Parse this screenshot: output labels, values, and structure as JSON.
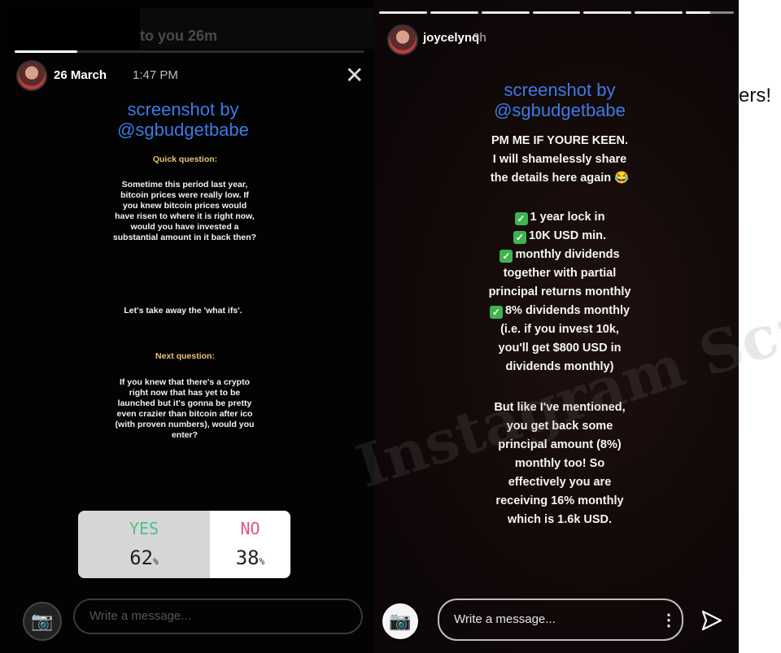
{
  "page": {
    "side_text": "ers!",
    "watermark": "Instagram Scammers"
  },
  "story1": {
    "behind_text": "to you 26m",
    "date": "26 March",
    "time": "1:47 PM",
    "close_icon": "close-icon",
    "progress_fraction": 0.18,
    "caption_line1": "screenshot by",
    "caption_line2": "@sgbudgetbabe",
    "q1_heading": "Quick question:",
    "q1_text": "Sometime this period last year, bitcoin prices were really low. If you knew bitcoin prices would have risen to where it is right now, would you have invested a substantial amount in it back then?",
    "q1_followup": "Let's take away the 'what ifs'.",
    "q2_heading": "Next question:",
    "q2_text": "If you knew that there's a crypto right now that has yet to be launched but it's gonna be pretty even crazier than bitcoin after ico (with proven numbers), would you enter?",
    "poll": {
      "yes_label": "YES",
      "yes_pct": "62",
      "no_label": "NO",
      "no_pct": "38",
      "pct_sign": "%",
      "yes_color": "#4fc08a",
      "no_color": "#e0557a"
    },
    "message_placeholder": "Write a message..."
  },
  "story2": {
    "username": "joycelynq",
    "time": "3h",
    "progress_segments": 7,
    "progress_last_fraction": 0.5,
    "caption_line1": "screenshot by",
    "caption_line2": "@sgbudgetbabe",
    "intro_line1": "PM ME IF YOURE KEEN.",
    "intro_line2": "I will shamelessly share",
    "intro_line3": "the details here again 😂",
    "bullet1": "1 year lock in",
    "bullet2": "10K USD min.",
    "bullet3_a": "monthly dividends",
    "bullet3_b": "together with partial",
    "bullet3_c": "principal returns monthly",
    "bullet4_a": "8% dividends monthly",
    "bullet4_b": "(i.e. if you invest 10k,",
    "bullet4_c": "you'll get $800 USD in",
    "bullet4_d": "dividends monthly)",
    "outro1": "But like I've mentioned,",
    "outro2": "you get back some",
    "outro3": "principal amount (8%)",
    "outro4": "monthly too! So",
    "outro5": "effectively you are",
    "outro6": "receiving 16% monthly",
    "outro7": "which is 1.6k USD.",
    "check_glyph": "✓",
    "message_placeholder": "Write a message...",
    "dots_glyph": "⋮"
  },
  "colors": {
    "caption_blue": "#3b7be6",
    "heading_gold": "#e8c27a",
    "check_green": "#3fb34f"
  }
}
